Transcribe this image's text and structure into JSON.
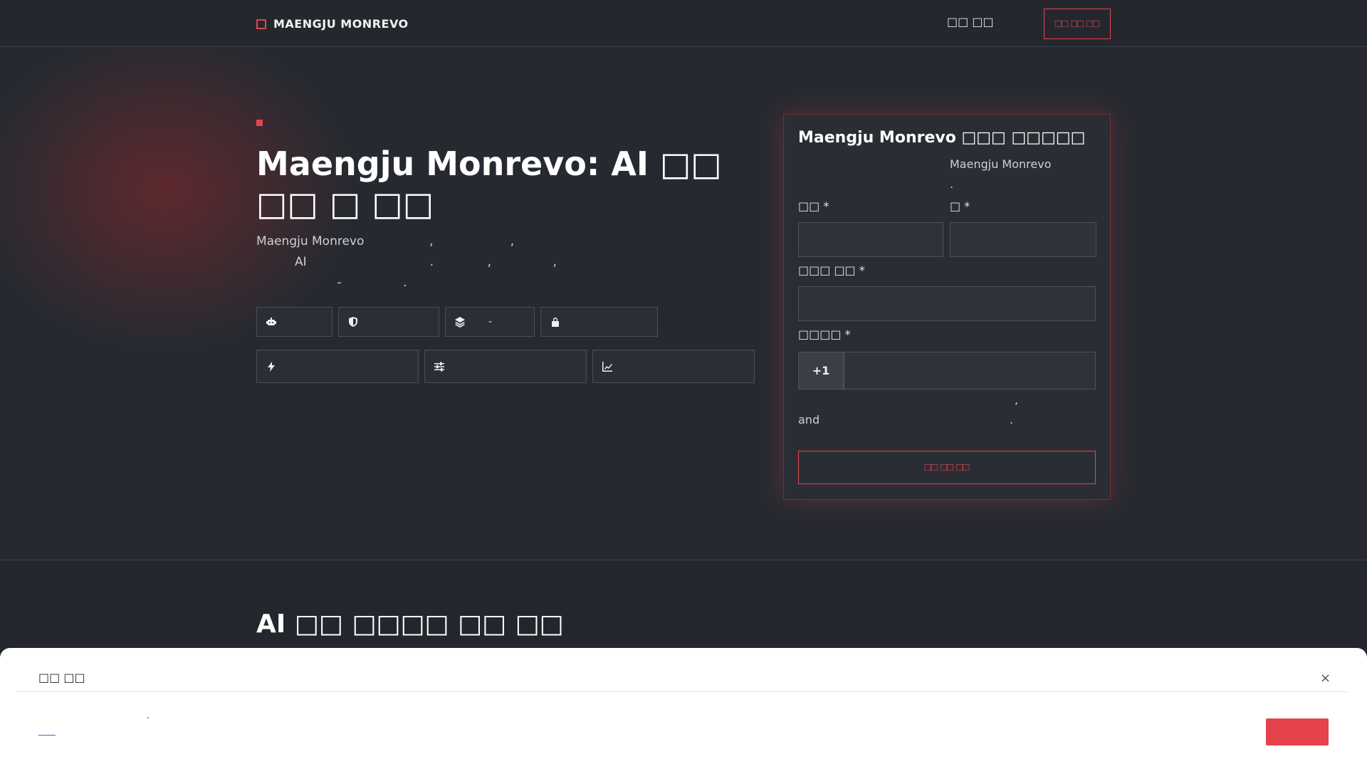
{
  "nav": {
    "brand": "MAENGJU MONREVO",
    "link": "□□ □□",
    "cta": "□□ □□ □□"
  },
  "hero": {
    "title": "Maengju Monrevo: AI □□ □□ □ □□",
    "desc_line1": "Maengju Monrevo                 ,                    ,",
    "desc_line2": "          AI                                .              ,                ,",
    "desc_line3": "                     -                .",
    "chips_row1": [
      "",
      "",
      "-",
      ""
    ],
    "chips_row2": [
      "",
      "",
      ""
    ],
    "chip_icons_row1": [
      "robot-icon",
      "shield-icon",
      "layers-icon",
      "lock-icon"
    ],
    "chip_icons_row2": [
      "bolt-icon",
      "sliders-icon",
      "chart-line-icon"
    ]
  },
  "form": {
    "title": "Maengju Monrevo □□□ □□□□□",
    "subtitle_brand": "Maengju Monrevo",
    "subtitle_end": ".",
    "first_name_label": "□□",
    "last_name_label": "□",
    "email_label": "□□□ □□",
    "phone_label": "□□□□",
    "required_mark": "*",
    "phone_prefix": "+1",
    "consent_and": "and",
    "consent_comma": ",",
    "consent_period": ".",
    "submit": "□□ □□ □□"
  },
  "section2": {
    "title": "AI □□ □□□□ □□ □□"
  },
  "cookie": {
    "heading": "□□ □□",
    "close": "×",
    "text": "."
  },
  "colors": {
    "accent": "#e5434b",
    "background": "#23272d",
    "card": "#2a2e34"
  }
}
